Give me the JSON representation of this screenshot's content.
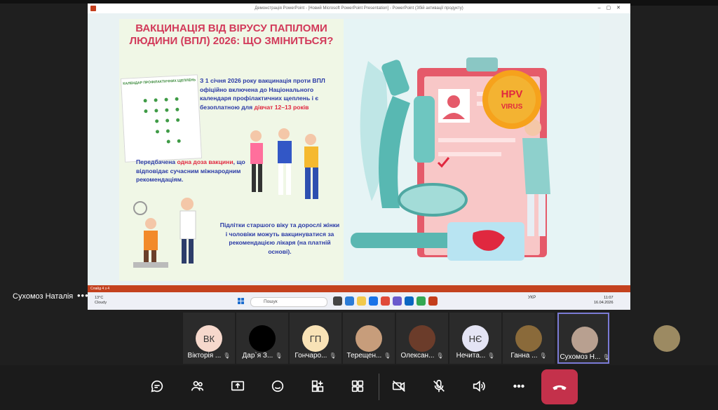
{
  "window": {
    "title": "Демонстрація PowerPoint - [Новий Microsoft PowerPoint Presentation] - PowerPoint (Збій активації продукту)"
  },
  "slide": {
    "title": "ВАКЦИНАЦІЯ ВІД ВІРУСУ ПАПІЛОМИ ЛЮДИНИ (ВПЛ) 2026: ЩО ЗМІНИТЬСЯ?",
    "calendar_heading": "КАЛЕНДАР ПРОФІЛАКТИЧНИХ ЩЕПЛЕНЬ",
    "para1_a": "З 1 січня 2026 року вакцинація проти ВПЛ офіційно включена до Національного календаря профілактичних щеплень і є безоплатною для ",
    "para1_red": "дівчат 12–13 років",
    "para2_a": "Передбачена ",
    "para2_red": "одна доза вакцини",
    "para2_b": ", що відповідає сучасним міжнародним рекомендаціям.",
    "para3": "Підлітки старшого віку та дорослі жінки і чоловіки можуть вакцинуватися за рекомендацією лікаря (на платній основі).",
    "badge_line1": "HPV",
    "badge_line2": "VIRUS"
  },
  "ppt_status": {
    "slide_label": "Слайд 4 з 4"
  },
  "taskbar": {
    "weather_temp": "13°C",
    "weather_desc": "Cloudy",
    "search_placeholder": "Пошук",
    "lang": "УКР",
    "time": "11:07",
    "date": "16.04.2026"
  },
  "presenter": {
    "name": "Сухомоз Наталія",
    "more": "•••"
  },
  "participants": [
    {
      "initials": "ВК",
      "name": "Вікторія ...",
      "color": "#f6d8cc"
    },
    {
      "initials": "",
      "name": "Дар`я З...",
      "color": "#000000"
    },
    {
      "initials": "ГП",
      "name": "Гончаро...",
      "color": "#f8e2b6"
    },
    {
      "initials": "",
      "name": "Терещен...",
      "color": "#c79d7b"
    },
    {
      "initials": "",
      "name": "Олексан...",
      "color": "#6b3c2a"
    },
    {
      "initials": "НЄ",
      "name": "Нечита...",
      "color": "#e4e4f4"
    },
    {
      "initials": "",
      "name": "Ганна ...",
      "color": "#8a6a3a"
    },
    {
      "initials": "",
      "name": "Сухомоз Н...",
      "color": "#b8a090"
    }
  ],
  "controls": {
    "colors": {
      "hangup": "#c4314b",
      "accent": "#7b7bd6"
    }
  }
}
